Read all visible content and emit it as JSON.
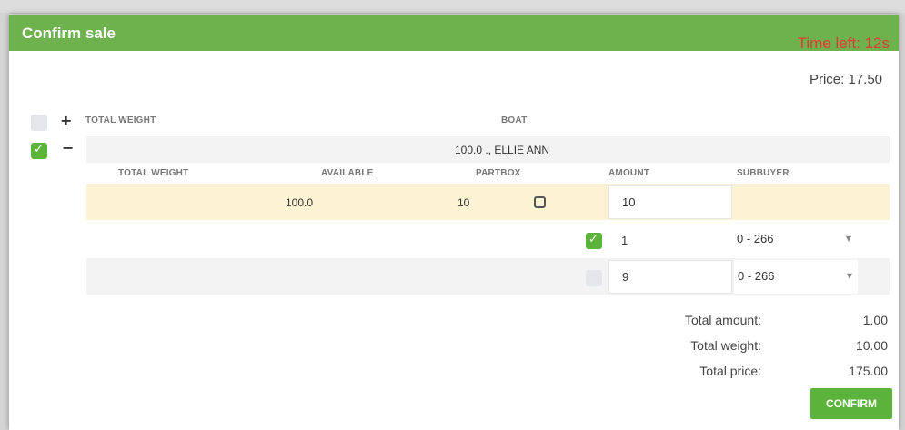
{
  "modal": {
    "title": "Confirm sale",
    "time_left": "Time left: 12s",
    "price": "Price: 17.50"
  },
  "group_header": {
    "columns": [
      "TOTAL WEIGHT",
      "BOAT"
    ]
  },
  "group_row": {
    "boat": "100.0 ., ELLIE ANN"
  },
  "detail_header": {
    "columns": [
      "TOTAL WEIGHT",
      "AVAILABLE",
      "PARTBOX",
      "AMOUNT",
      "SUBBUYER"
    ]
  },
  "detail_row": {
    "available": "100.0",
    "partbox": "10",
    "amount": "10"
  },
  "subbuyer_rows": [
    {
      "amount": "1",
      "subbuyer": "0 - 266",
      "checked": true
    },
    {
      "amount": "9",
      "subbuyer": "0 - 266",
      "checked": false
    }
  ],
  "totals": {
    "amount_label": "Total amount:",
    "amount_value": "1.00",
    "weight_label": "Total weight:",
    "weight_value": "10.00",
    "price_label": "Total price:",
    "price_value": "175.00"
  },
  "actions": {
    "confirm_label": "CONFIRM"
  },
  "colors": {
    "header_green": "#6db24d",
    "button_green": "#5cb33b",
    "timer_red": "#e53935",
    "highlight_row": "#fbf3d3"
  }
}
